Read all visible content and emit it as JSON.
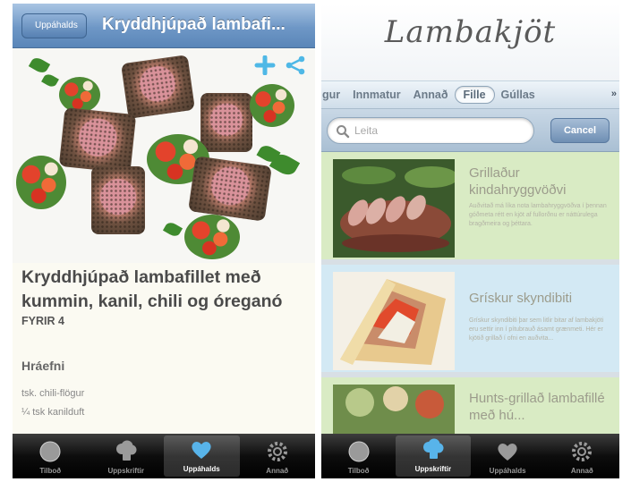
{
  "left": {
    "back_label": "Uppáhalds",
    "nav_title": "Kryddhjúpað lambafi...",
    "recipe_title": "Kryddhjúpað lambafillet með kummin, kanil, chili og óreganó",
    "serves": "FYRIR 4",
    "ingredients_heading": "Hráefni",
    "ingredients": [
      "tsk. chili-flögur",
      "¼ tsk kanilduft"
    ],
    "active_tab": "favorites"
  },
  "right": {
    "logo": "Lambakjöt",
    "segments": [
      "gur",
      "Innmatur",
      "Annað",
      "Fille",
      "Gúllas"
    ],
    "active_segment": "Fille",
    "search_placeholder": "Leita",
    "cancel_label": "Cancel",
    "items": [
      {
        "title": "Grillaður kindahryggvöðvi",
        "desc": "Auðvitað má líka nota lambahryggvöðva í þennan góðmeta rétt en kjöt af fullorðnu er náttúrulega bragðmeira og þéttara."
      },
      {
        "title": "Grískur skyndibiti",
        "desc": "Grískur skyndibiti þar sem litlir bitar af lambakjöti eru settir inn í pítubrauð ásamt grænmeti. Hér er kjötið grillað í ofni en auðvita..."
      },
      {
        "title": "Hunts-grillað lambafillé með hú..."
      }
    ],
    "active_tab": "recipes"
  },
  "tabbar": {
    "tabs": [
      {
        "key": "offers",
        "label": "Tilboð",
        "icon": "disc-icon"
      },
      {
        "key": "recipes",
        "label": "Uppskriftir",
        "icon": "chef-hat-icon"
      },
      {
        "key": "favorites",
        "label": "Uppáhalds",
        "icon": "heart-icon"
      },
      {
        "key": "other",
        "label": "Annað",
        "icon": "gear-icon"
      }
    ]
  },
  "colors": {
    "nav_blue": "#6e97c6",
    "item_green": "#d9ebc4",
    "item_blue": "#d3e9f4",
    "share_icon": "#4fb8e6"
  }
}
